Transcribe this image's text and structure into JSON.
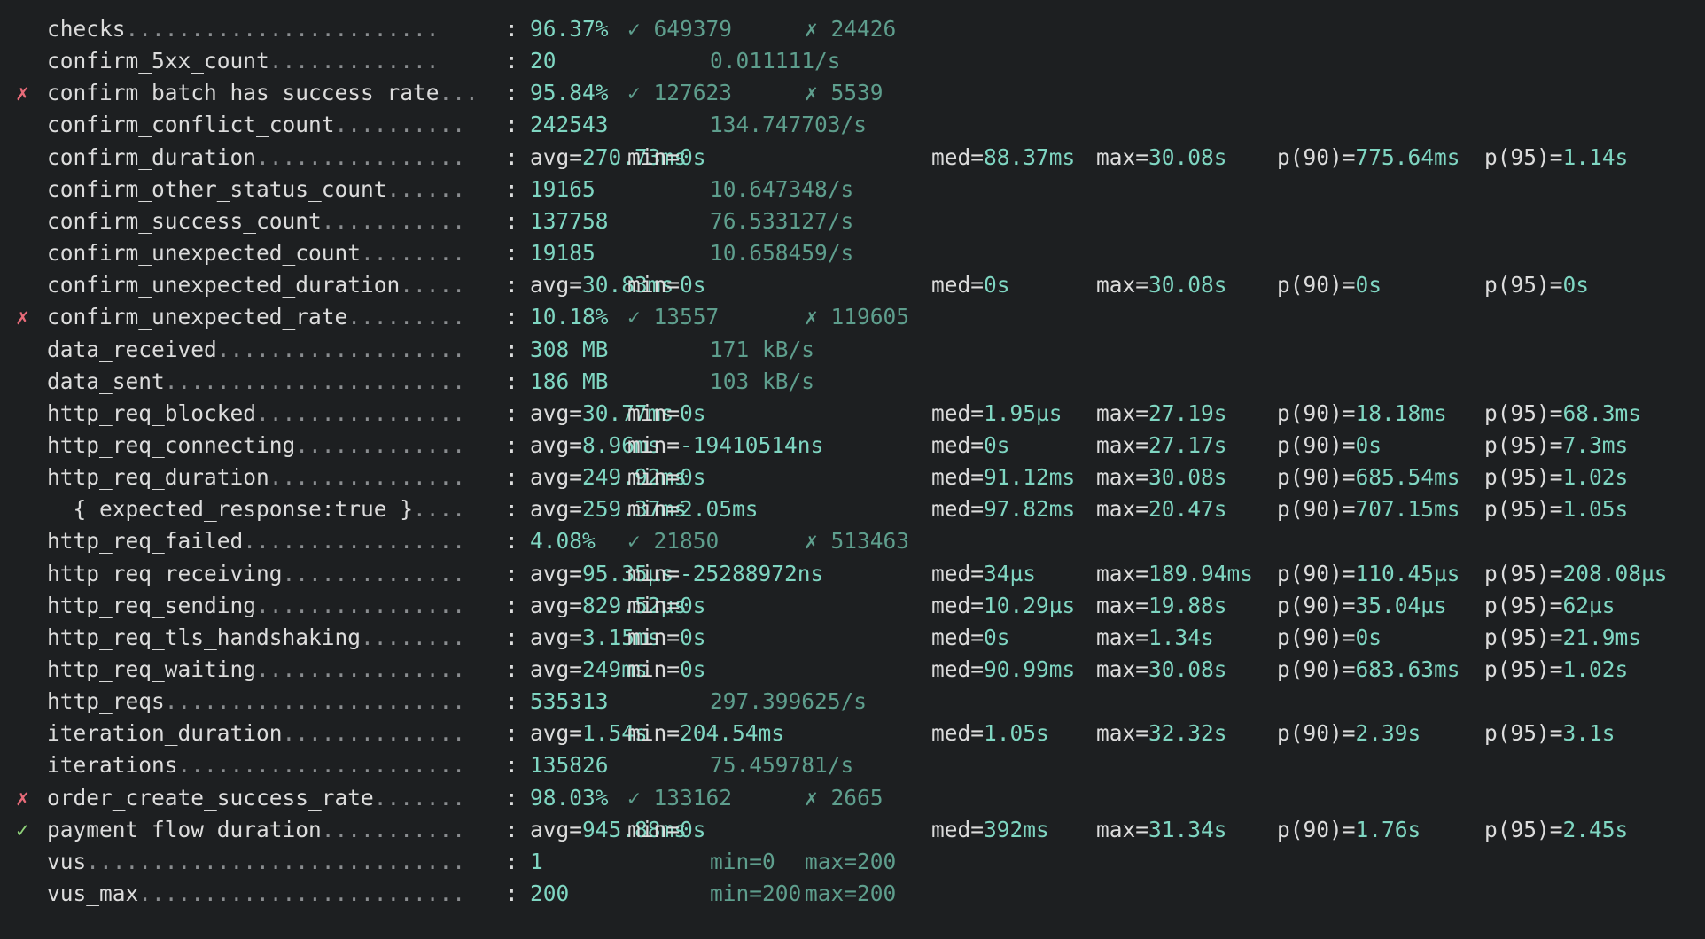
{
  "metrics": [
    {
      "name": "checks",
      "dots": "........................",
      "kind": "rate",
      "mark": "",
      "value": "96.37%",
      "pass_icon": "✓",
      "pass": "649379",
      "fail_icon": "✗",
      "fail": "24426"
    },
    {
      "name": "confirm_5xx_count",
      "dots": ".............",
      "kind": "counter",
      "mark": "",
      "value": "20",
      "rate": "0.011111/s"
    },
    {
      "name": "confirm_batch_has_success_rate",
      "dots": "...",
      "kind": "rate",
      "mark": "✗",
      "value": "95.84%",
      "pass_icon": "✓",
      "pass": "127623",
      "fail_icon": "✗",
      "fail": "5539"
    },
    {
      "name": "confirm_conflict_count",
      "dots": "..........",
      "kind": "counter",
      "mark": "",
      "value": "242543",
      "rate": "134.747703/s"
    },
    {
      "name": "confirm_duration",
      "dots": "................",
      "kind": "trend",
      "mark": "",
      "avg": "270.73ms",
      "min": "0s",
      "med": "88.37ms",
      "max": "30.08s",
      "p90": "775.64ms",
      "p95": "1.14s"
    },
    {
      "name": "confirm_other_status_count",
      "dots": "......",
      "kind": "counter",
      "mark": "",
      "value": "19165",
      "rate": "10.647348/s"
    },
    {
      "name": "confirm_success_count",
      "dots": "...........",
      "kind": "counter",
      "mark": "",
      "value": "137758",
      "rate": "76.533127/s"
    },
    {
      "name": "confirm_unexpected_count",
      "dots": "........",
      "kind": "counter",
      "mark": "",
      "value": "19185",
      "rate": "10.658459/s"
    },
    {
      "name": "confirm_unexpected_duration",
      "dots": ".....",
      "kind": "trend",
      "mark": "",
      "avg": "30.83ms",
      "min": "0s",
      "med": "0s",
      "max": "30.08s",
      "p90": "0s",
      "p95": "0s"
    },
    {
      "name": "confirm_unexpected_rate",
      "dots": ".........",
      "kind": "rate",
      "mark": "✗",
      "value": "10.18%",
      "pass_icon": "✓",
      "pass": "13557",
      "fail_icon": "✗",
      "fail": "119605"
    },
    {
      "name": "data_received",
      "dots": "...................",
      "kind": "counter",
      "mark": "",
      "value": "308 MB",
      "rate": "171 kB/s"
    },
    {
      "name": "data_sent",
      "dots": ".......................",
      "kind": "counter",
      "mark": "",
      "value": "186 MB",
      "rate": "103 kB/s"
    },
    {
      "name": "http_req_blocked",
      "dots": "................",
      "kind": "trend",
      "mark": "",
      "avg": "30.77ms",
      "min": "0s",
      "med": "1.95µs",
      "max": "27.19s",
      "p90": "18.18ms",
      "p95": "68.3ms"
    },
    {
      "name": "http_req_connecting",
      "dots": ".............",
      "kind": "trend",
      "mark": "",
      "avg": "8.96ms",
      "min": "-19410514ns",
      "med": "0s",
      "max": "27.17s",
      "p90": "0s",
      "p95": "7.3ms"
    },
    {
      "name": "http_req_duration",
      "dots": "...............",
      "kind": "trend",
      "mark": "",
      "avg": "249.92ms",
      "min": "0s",
      "med": "91.12ms",
      "max": "30.08s",
      "p90": "685.54ms",
      "p95": "1.02s"
    },
    {
      "name": "  { expected_response:true }",
      "dots": "....",
      "kind": "trend",
      "mark": "",
      "avg": "259.37ms",
      "min": "2.05ms",
      "med": "97.82ms",
      "max": "20.47s",
      "p90": "707.15ms",
      "p95": "1.05s"
    },
    {
      "name": "http_req_failed",
      "dots": ".................",
      "kind": "rate",
      "mark": "",
      "value": "4.08%",
      "pass_icon": "✓",
      "pass": "21850",
      "fail_icon": "✗",
      "fail": "513463"
    },
    {
      "name": "http_req_receiving",
      "dots": "..............",
      "kind": "trend",
      "mark": "",
      "avg": "95.35µs",
      "min": "-25288972ns",
      "med": "34µs",
      "max": "189.94ms",
      "p90": "110.45µs",
      "p95": "208.08µs"
    },
    {
      "name": "http_req_sending",
      "dots": "................",
      "kind": "trend",
      "mark": "",
      "avg": "829.52µs",
      "min": "0s",
      "med": "10.29µs",
      "max": "19.88s",
      "p90": "35.04µs",
      "p95": "62µs"
    },
    {
      "name": "http_req_tls_handshaking",
      "dots": "........",
      "kind": "trend",
      "mark": "",
      "avg": "3.15ms",
      "min": "0s",
      "med": "0s",
      "max": "1.34s",
      "p90": "0s",
      "p95": "21.9ms"
    },
    {
      "name": "http_req_waiting",
      "dots": "................",
      "kind": "trend",
      "mark": "",
      "avg": "249ms",
      "min": "0s",
      "med": "90.99ms",
      "max": "30.08s",
      "p90": "683.63ms",
      "p95": "1.02s"
    },
    {
      "name": "http_reqs",
      "dots": ".......................",
      "kind": "counter",
      "mark": "",
      "value": "535313",
      "rate": "297.399625/s"
    },
    {
      "name": "iteration_duration",
      "dots": "..............",
      "kind": "trend",
      "mark": "",
      "avg": "1.54s",
      "min": "204.54ms",
      "med": "1.05s",
      "max": "32.32s",
      "p90": "2.39s",
      "p95": "3.1s"
    },
    {
      "name": "iterations",
      "dots": "......................",
      "kind": "counter",
      "mark": "",
      "value": "135826",
      "rate": "75.459781/s"
    },
    {
      "name": "order_create_success_rate",
      "dots": ".......",
      "kind": "rate",
      "mark": "✗",
      "value": "98.03%",
      "pass_icon": "✓",
      "pass": "133162",
      "fail_icon": "✗",
      "fail": "2665"
    },
    {
      "name": "payment_flow_duration",
      "dots": "...........",
      "kind": "trend",
      "mark": "✓",
      "avg": "945.88ms",
      "min": "0s",
      "med": "392ms",
      "max": "31.34s",
      "p90": "1.76s",
      "p95": "2.45s"
    },
    {
      "name": "vus",
      "dots": ".............................",
      "kind": "gauge",
      "mark": "",
      "value": "1",
      "min": "min=0",
      "max": "max=200"
    },
    {
      "name": "vus_max",
      "dots": ".........................",
      "kind": "gauge",
      "mark": "",
      "value": "200",
      "min": "min=200",
      "max": "max=200"
    }
  ],
  "labels": {
    "colon": ":",
    "avg": "avg=",
    "min": "min=",
    "med": "med=",
    "max": "max=",
    "p90": "p(90)=",
    "p95": "p(95)="
  },
  "colors": {
    "background": "#1d1f21",
    "value": "#7fd6c2",
    "secondary": "#5e9e8d",
    "fail_mark": "#e86b79",
    "pass_mark": "#8fd27a",
    "text": "#dcdcdc",
    "dots": "#8a8d90"
  }
}
